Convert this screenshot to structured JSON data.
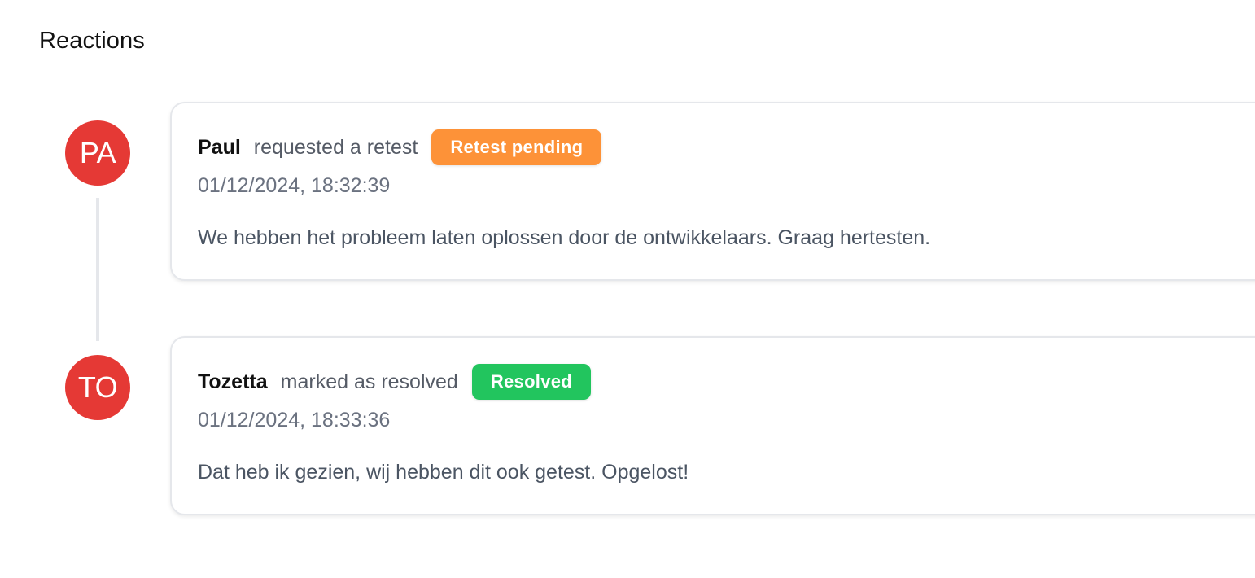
{
  "section": {
    "title": "Reactions"
  },
  "reactions": [
    {
      "initials": "PA",
      "author": "Paul",
      "action": "requested a retest",
      "badge": "Retest pending",
      "timestamp": "01/12/2024, 18:32:39",
      "message": "We hebben het probleem laten oplossen door de ontwikkelaars. Graag hertesten."
    },
    {
      "initials": "TO",
      "author": "Tozetta",
      "action": "marked as resolved",
      "badge": "Resolved",
      "timestamp": "01/12/2024, 18:33:36",
      "message": "Dat heb ik gezien, wij hebben dit ook getest. Opgelost!"
    }
  ],
  "colors": {
    "avatar": "#e53935",
    "badge_retest_pending": "#fd9238",
    "badge_resolved": "#22c55e"
  }
}
